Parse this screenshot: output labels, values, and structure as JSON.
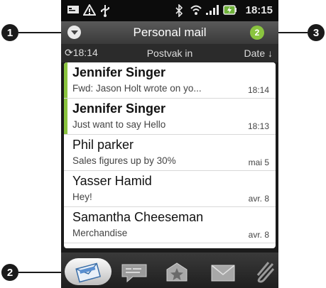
{
  "callouts": {
    "one": "1",
    "two": "2",
    "three": "3"
  },
  "status_bar": {
    "time": "18:15"
  },
  "header": {
    "title": "Personal mail",
    "unread_count": "2"
  },
  "filter_bar": {
    "sync_time": "18:14",
    "folder": "Postvak in",
    "sort_label": "Date ↓"
  },
  "messages": [
    {
      "sender": "Jennifer Singer",
      "preview": "Fwd: Jason Holt wrote on yo...",
      "time": "18:14",
      "unread": true
    },
    {
      "sender": "Jennifer Singer",
      "preview": "Just want to say Hello",
      "time": "18:13",
      "unread": true
    },
    {
      "sender": "Phil parker",
      "preview": "Sales figures up by 30%",
      "time": "mai 5",
      "unread": false
    },
    {
      "sender": "Yasser Hamid",
      "preview": "Hey!",
      "time": "avr. 8",
      "unread": false
    },
    {
      "sender": "Samantha Cheeseman",
      "preview": "Merchandise",
      "time": "avr. 8",
      "unread": false
    }
  ],
  "tabs": [
    {
      "icon": "inbox-icon",
      "selected": true
    },
    {
      "icon": "conversations-icon",
      "selected": false
    },
    {
      "icon": "favorites-icon",
      "selected": false
    },
    {
      "icon": "unread-icon",
      "selected": false
    },
    {
      "icon": "attachments-icon",
      "selected": false
    }
  ],
  "colors": {
    "unread_bar": "#8ac43f",
    "badge": "#8ac43f",
    "callout": "#1a1a1a"
  }
}
